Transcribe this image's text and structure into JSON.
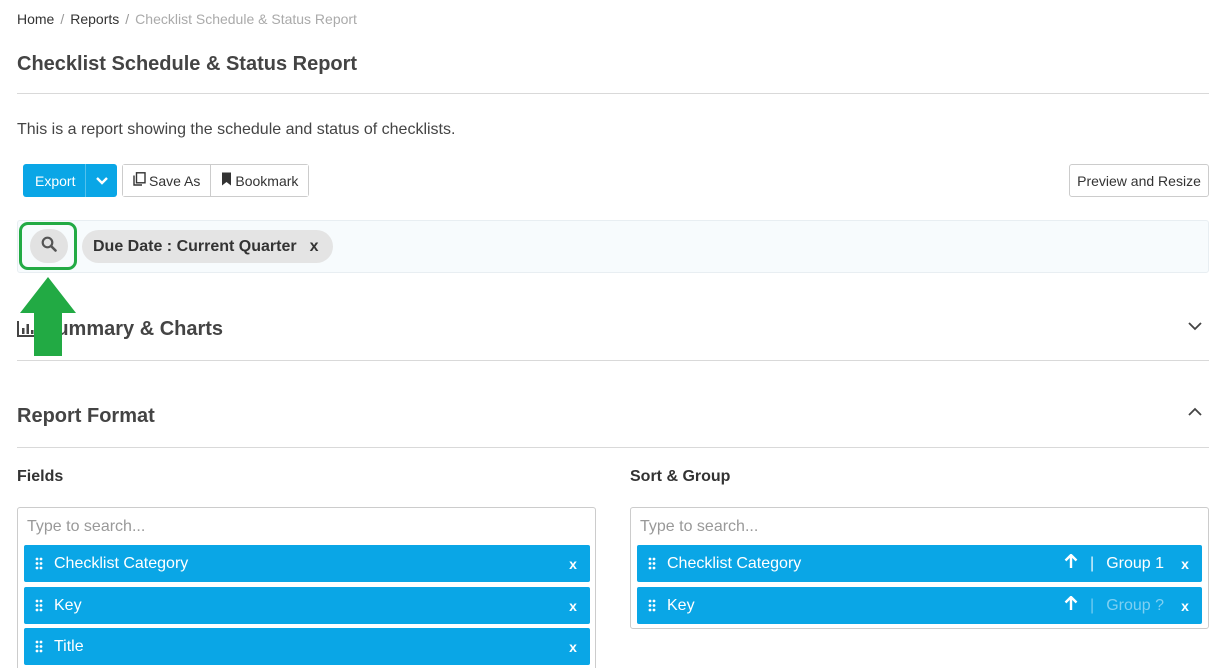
{
  "breadcrumb": {
    "home": "Home",
    "sep": "/",
    "reports": "Reports",
    "current": "Checklist Schedule & Status Report"
  },
  "page": {
    "title": "Checklist Schedule & Status Report",
    "description": "This is a report showing the schedule and status of checklists."
  },
  "toolbar": {
    "export_label": "Export",
    "save_as_label": "Save As",
    "bookmark_label": "Bookmark",
    "preview_label": "Preview and Resize"
  },
  "filter": {
    "chip_label": "Due Date : Current Quarter",
    "chip_remove": "x"
  },
  "sections": {
    "summary_title": "Summary & Charts",
    "format_title": "Report Format"
  },
  "fields": {
    "label": "Fields",
    "placeholder": "Type to search...",
    "items": [
      {
        "name": "Checklist Category",
        "remove": "x"
      },
      {
        "name": "Key",
        "remove": "x"
      },
      {
        "name": "Title",
        "remove": "x"
      }
    ]
  },
  "sort_group": {
    "label": "Sort & Group",
    "placeholder": "Type to search...",
    "separator": "|",
    "items": [
      {
        "name": "Checklist Category",
        "group": "Group 1",
        "remove": "x"
      },
      {
        "name": "Key",
        "group": "Group ?",
        "remove": "x"
      }
    ]
  },
  "colors": {
    "accent": "#0aa6e6",
    "highlight": "#22aa44"
  }
}
